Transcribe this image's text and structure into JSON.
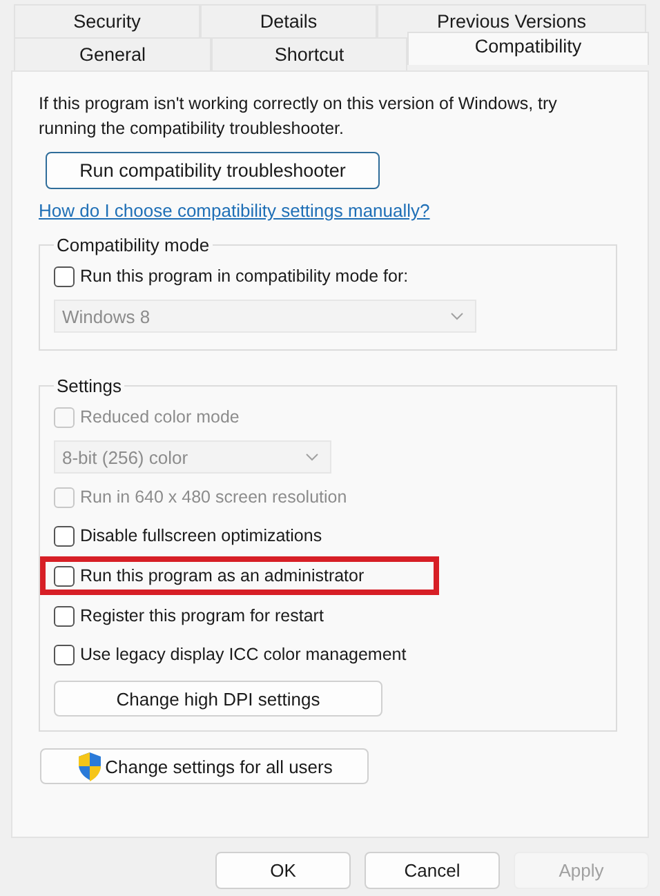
{
  "tab_rows": [
    [
      {
        "label": "Security",
        "selected": false
      },
      {
        "label": "Details",
        "selected": false
      },
      {
        "label": "Previous Versions",
        "selected": false
      }
    ],
    [
      {
        "label": "General",
        "selected": false
      },
      {
        "label": "Shortcut",
        "selected": false
      },
      {
        "label": "Compatibility",
        "selected": true
      }
    ]
  ],
  "intro": "If this program isn't working correctly on this version of Windows, try running the compatibility troubleshooter.",
  "troubleshooter_button": "Run compatibility troubleshooter",
  "help_link": "How do I choose compatibility settings manually?",
  "compatibility_mode": {
    "title": "Compatibility mode",
    "items": [
      {
        "kind": "checkbox",
        "label": "Run this program in compatibility mode for:",
        "checked": false,
        "disabled": false,
        "highlighted": false
      },
      {
        "kind": "dropdown",
        "value": "Windows 8",
        "disabled": true
      }
    ]
  },
  "settings": {
    "title": "Settings",
    "items": [
      {
        "kind": "checkbox",
        "label": "Reduced color mode",
        "checked": false,
        "disabled": true,
        "highlighted": false
      },
      {
        "kind": "dropdown",
        "value": "8-bit (256) color",
        "disabled": true
      },
      {
        "kind": "checkbox",
        "label": "Run in 640 x 480 screen resolution",
        "checked": false,
        "disabled": true,
        "highlighted": false
      },
      {
        "kind": "checkbox",
        "label": "Disable fullscreen optimizations",
        "checked": false,
        "disabled": false,
        "highlighted": false
      },
      {
        "kind": "checkbox",
        "label": "Run this program as an administrator",
        "checked": false,
        "disabled": false,
        "highlighted": true
      },
      {
        "kind": "checkbox",
        "label": "Register this program for restart",
        "checked": false,
        "disabled": false,
        "highlighted": false
      },
      {
        "kind": "checkbox",
        "label": "Use legacy display ICC color management",
        "checked": false,
        "disabled": false,
        "highlighted": false
      },
      {
        "kind": "button",
        "label": "Change high DPI settings"
      }
    ]
  },
  "all_users_button": "Change settings for all users",
  "buttons": [
    {
      "label": "OK",
      "disabled": false
    },
    {
      "label": "Cancel",
      "disabled": false
    },
    {
      "label": "Apply",
      "disabled": true
    }
  ]
}
